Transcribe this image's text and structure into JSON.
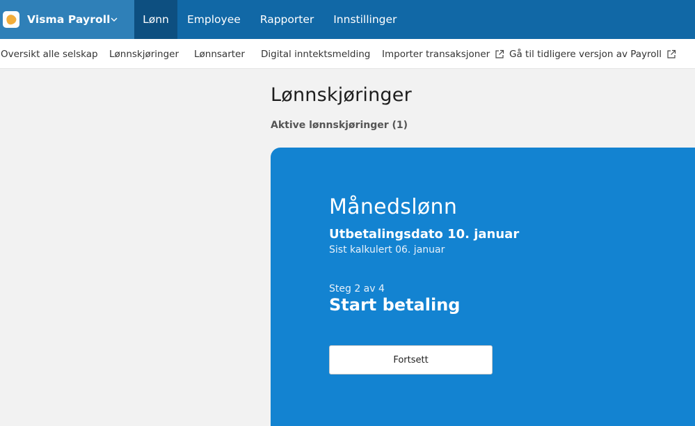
{
  "app": {
    "name": "Visma Payroll",
    "logo_icon": "visma-logo-icon",
    "menu_icon": "chevron-down-icon"
  },
  "topnav": {
    "tabs": [
      {
        "label": "Lønn",
        "active": true
      },
      {
        "label": "Employee",
        "active": false
      },
      {
        "label": "Rapporter",
        "active": false
      },
      {
        "label": "Innstillinger",
        "active": false
      }
    ]
  },
  "subnav": {
    "items": [
      {
        "label": "Oversikt alle selskap",
        "external": false
      },
      {
        "label": "Lønnskjøringer",
        "external": false
      },
      {
        "label": "Lønnsarter",
        "external": false
      },
      {
        "label": "Digital inntektsmelding",
        "external": false
      },
      {
        "label": "Importer transaksjoner",
        "external": true,
        "icon": "external-link-icon"
      },
      {
        "label": "Gå til tidligere versjon av Payroll",
        "external": true,
        "icon": "external-link-icon"
      }
    ]
  },
  "main": {
    "title": "Lønnskjøringer",
    "section_title": "Aktive lønnskjøringer (1)",
    "card": {
      "title": "Månedslønn",
      "pay_date": "Utbetalingsdato 10. januar",
      "calculated": "Sist kalkulert 06. januar",
      "step": "Steg 2 av 4",
      "action": "Start betaling",
      "button_label": "Fortsett"
    }
  },
  "colors": {
    "topbar": "#1168a6",
    "brand_bg": "#2f80b8",
    "active_tab": "#0d4f80",
    "card": "#1383d1",
    "page_bg": "#f2f2f2"
  }
}
